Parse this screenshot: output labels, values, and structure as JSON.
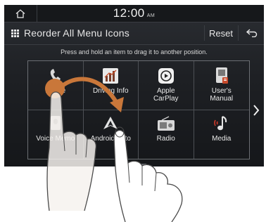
{
  "status": {
    "time": "12:00",
    "ampm": "AM",
    "home_icon": "home-icon"
  },
  "header": {
    "title": "Reorder All Menu Icons",
    "reset_label": "Reset",
    "back_icon": "back-arrow-icon",
    "menu_icon": "grid-menu-icon"
  },
  "instruction": "Press and hold an item to drag it to another position.",
  "menu_items": [
    {
      "label": "Phone",
      "icon": "phone-icon"
    },
    {
      "label": "Driving Info",
      "icon": "driving-info-chart-icon"
    },
    {
      "label": "Apple\nCarPlay",
      "icon": "apple-carplay-icon"
    },
    {
      "label": "User's\nManual",
      "icon": "users-manual-icon"
    },
    {
      "label": "Voice Memo",
      "icon": "voice-memo-icon"
    },
    {
      "label": "Android Auto",
      "icon": "android-auto-icon"
    },
    {
      "label": "Radio",
      "icon": "radio-icon"
    },
    {
      "label": "Media",
      "icon": "media-icon"
    }
  ],
  "colors": {
    "accent": "#d9822b",
    "drag_dot": "#c9773a",
    "background": "#1e2024",
    "text": "#e9e9e9"
  },
  "pager": {
    "pages": 2,
    "current": 1
  },
  "next_icon": "chevron-right-icon"
}
